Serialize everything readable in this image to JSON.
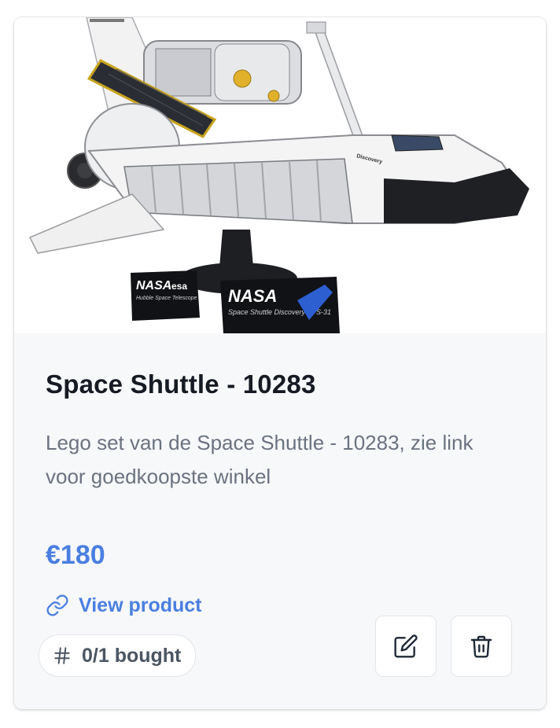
{
  "product": {
    "image_alt": "LEGO Space Shuttle Discovery with Hubble Space Telescope",
    "image_labels": {
      "plaque_left_logo": "NASA",
      "plaque_left_agency": "esa",
      "plaque_left_subtitle": "Hubble Space Telescope",
      "plaque_right_logo": "NASA",
      "plaque_right_subtitle": "Space Shuttle Discovery STS-31",
      "shuttle_name": "Discovery"
    },
    "title": "Space Shuttle - 10283",
    "description": "Lego set van de Space Shuttle - 10283, zie link voor goedkoopste winkel",
    "price": "€180",
    "link_label": "View product",
    "bought_label": "0/1 bought"
  },
  "icons": {
    "link": "link-icon",
    "hash": "hash-icon",
    "edit": "edit-icon",
    "delete": "trash-icon"
  },
  "colors": {
    "accent": "#4a7fe0",
    "title": "#161a23",
    "muted": "#6b7280",
    "card_bg": "#f7f8fa"
  }
}
